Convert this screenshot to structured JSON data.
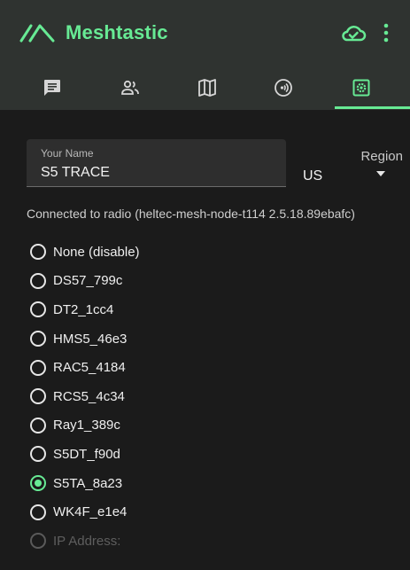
{
  "app": {
    "title": "Meshtastic",
    "accent": "#67ea94",
    "icons": {
      "logo": "meshtastic-logo-icon",
      "cloud": "cloud-check-icon",
      "menu": "more-vert-icon"
    }
  },
  "tabs": [
    {
      "icon": "chat-icon",
      "selected": false
    },
    {
      "icon": "people-icon",
      "selected": false
    },
    {
      "icon": "map-icon",
      "selected": false
    },
    {
      "icon": "radio-signal-icon",
      "selected": false
    },
    {
      "icon": "settings-icon",
      "selected": true
    }
  ],
  "settings": {
    "name_label": "Your Name",
    "name_value": "S5 TRACE",
    "region_label": "Region",
    "region_value": "US",
    "status": "Connected to radio (heltec-mesh-node-t114 2.5.18.89ebafc)"
  },
  "devices": [
    {
      "label": "None (disable)",
      "checked": false
    },
    {
      "label": "DS57_799c",
      "checked": false
    },
    {
      "label": "DT2_1cc4",
      "checked": false
    },
    {
      "label": "HMS5_46e3",
      "checked": false
    },
    {
      "label": "RAC5_4184",
      "checked": false
    },
    {
      "label": "RCS5_4c34",
      "checked": false
    },
    {
      "label": "Ray1_389c",
      "checked": false
    },
    {
      "label": "S5DT_f90d",
      "checked": false
    },
    {
      "label": "S5TA_8a23",
      "checked": true
    },
    {
      "label": "WK4F_e1e4",
      "checked": false
    },
    {
      "label": "IP Address:",
      "checked": false,
      "disabled": true
    }
  ]
}
